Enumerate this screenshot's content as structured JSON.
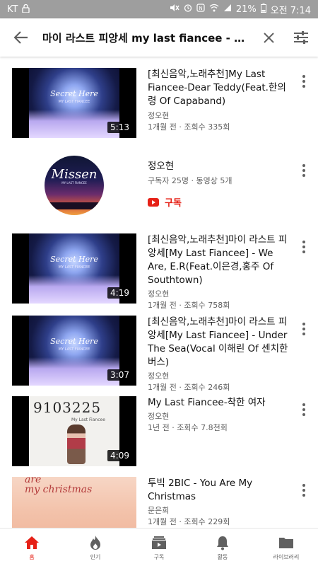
{
  "status_bar": {
    "carrier": "KT",
    "lock_icon": "lock-icon",
    "battery": "21%",
    "time": "오전 7:14"
  },
  "search": {
    "query": "마이 라스트 피앙세 my last fiancee - de...",
    "back_icon": "arrow-left-icon",
    "clear_icon": "close-icon",
    "filter_icon": "filter-sliders-icon"
  },
  "results": [
    {
      "type": "video",
      "art": "moon",
      "art_text": "Secret Here",
      "art_subtext": "MY LAST FIANCEE",
      "duration": "5:13",
      "title": "[최신음악,노래추천]My Last Fiancee-Dear Teddy(Feat.한의령 Of Capaband)",
      "channel": "정오현",
      "meta": "1개월 전 · 조회수 335회"
    },
    {
      "type": "channel",
      "art_text": "Missen",
      "art_subtext": "MY LAST FIANCEE",
      "name": "정오현",
      "meta": "구독자 25명 · 동영상 5개",
      "subscribe_label": "구독"
    },
    {
      "type": "video",
      "art": "moon",
      "art_text": "Secret Here",
      "art_subtext": "MY LAST FIANCEE",
      "duration": "4:19",
      "title": "[최신음악,노래추천]마이 라스트 피앙세[My Last Fiancee] - We Are, E.R(Feat.이은경,홍주 Of Southtown)",
      "channel": "정오현",
      "meta": "1개월 전 · 조회수 758회"
    },
    {
      "type": "video",
      "art": "moon",
      "art_text": "Secret Here",
      "art_subtext": "MY LAST FIANCEE",
      "duration": "3:07",
      "title": "[최신음악,노래추천]마이 라스트 피앙세[My Last Fiancee] - Under The Sea(Vocal 이해린 Of 센치한버스)",
      "channel": "정오현",
      "meta": "1개월 전 · 조회수 246회"
    },
    {
      "type": "video",
      "art": "sketch",
      "art_text": "9103225",
      "art_subtext": "My Last Fiancee",
      "duration": "4:09",
      "title": "My Last Fiancee-착한 여자",
      "channel": "정오현",
      "meta": "1년 전 · 조회수 7.8천회"
    },
    {
      "type": "video",
      "art": "pink",
      "art_text": "are",
      "art_subtext": "my christmas",
      "duration": "",
      "title": "투빅 2BIC - You Are My Christmas",
      "channel": "문은희",
      "meta": "1개월 전 · 조회수 229회"
    }
  ],
  "bottom_nav": [
    {
      "label": "홈",
      "icon": "home-icon",
      "active": true
    },
    {
      "label": "인기",
      "icon": "flame-icon",
      "active": false
    },
    {
      "label": "구독",
      "icon": "subscriptions-icon",
      "active": false
    },
    {
      "label": "활동",
      "icon": "bell-icon",
      "active": false
    },
    {
      "label": "라이브러리",
      "icon": "folder-icon",
      "active": false
    }
  ],
  "colors": {
    "status_bar": "#9e9e9e",
    "accent_red": "#e62117",
    "text_primary": "#111111",
    "text_secondary": "#606060"
  }
}
